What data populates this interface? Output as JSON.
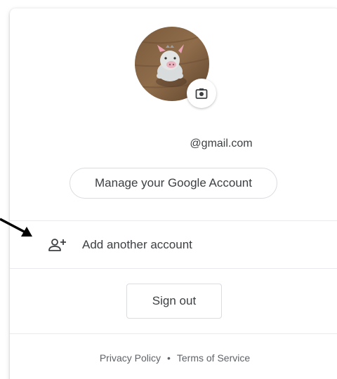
{
  "account": {
    "email": "@gmail.com",
    "manage_label": "Manage your Google Account"
  },
  "actions": {
    "add_account_label": "Add another account",
    "sign_out_label": "Sign out"
  },
  "footer": {
    "privacy_label": "Privacy Policy",
    "separator": "•",
    "terms_label": "Terms of Service"
  },
  "icons": {
    "avatar": "avatar-photo",
    "camera": "camera-icon",
    "add_account": "person-add-icon",
    "annotation": "arrow-pointer"
  },
  "colors": {
    "text": "#3c4043",
    "secondary_text": "#5f6368",
    "border": "#dadce0",
    "divider": "#e8eaed"
  }
}
